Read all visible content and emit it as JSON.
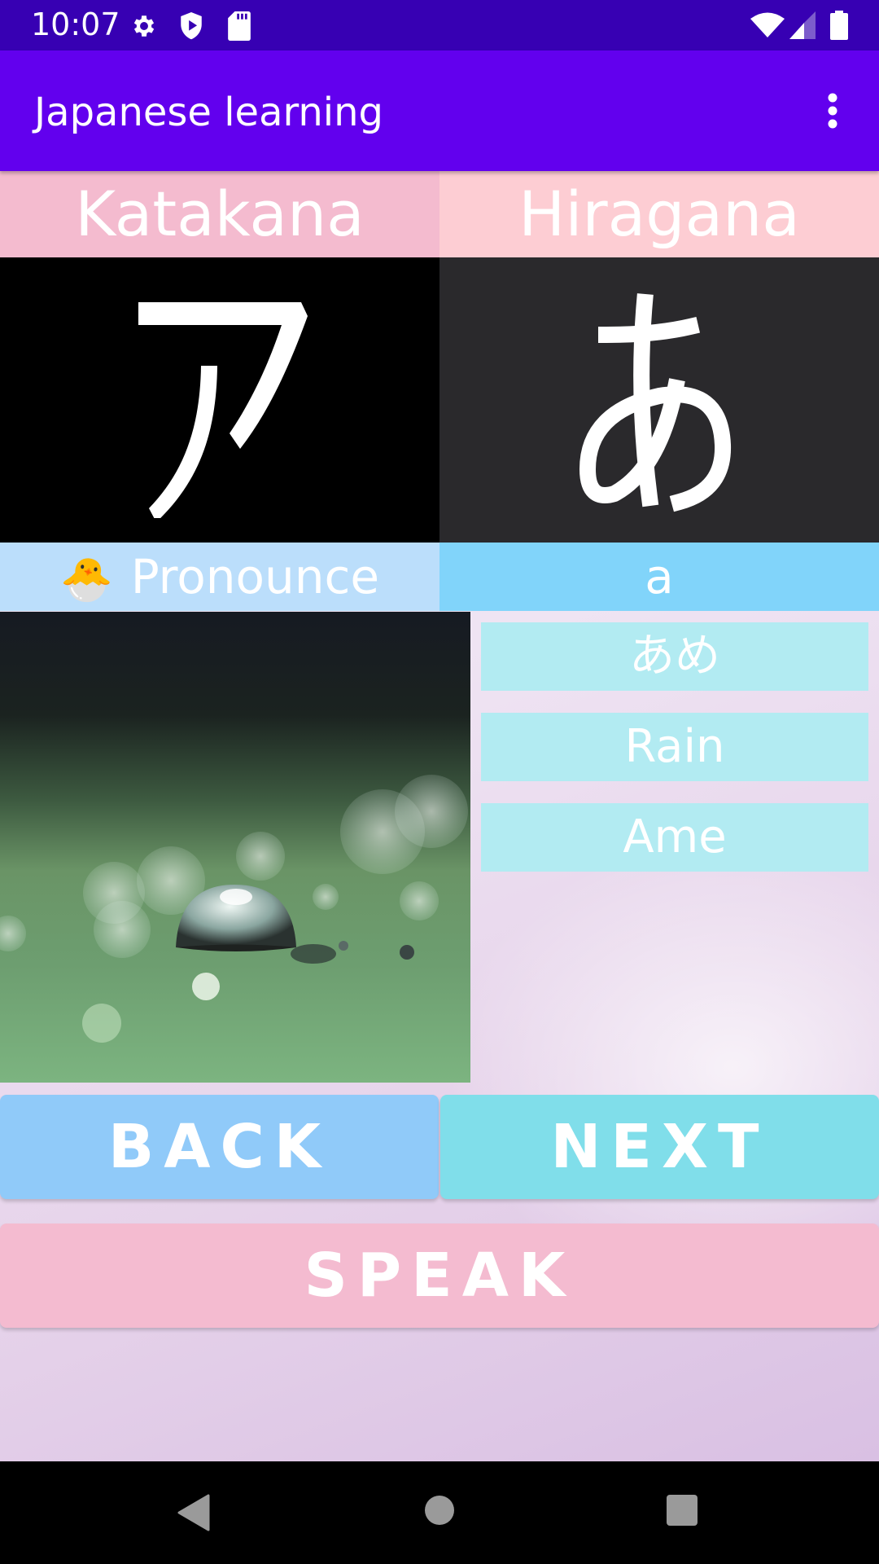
{
  "status_bar": {
    "time": "10:07",
    "left_icons": [
      "gear-icon",
      "shield-play-icon",
      "sd-card-icon"
    ],
    "right_icons": [
      "wifi-icon",
      "cell-signal-icon",
      "battery-icon"
    ]
  },
  "app_bar": {
    "title": "Japanese learning",
    "menu_icon": "more-vert-icon"
  },
  "tabs": {
    "katakana": "Katakana",
    "hiragana": "Hiragana"
  },
  "characters": {
    "katakana": "ア",
    "hiragana": "あ"
  },
  "pronounce": {
    "emoji": "🐣",
    "label": "Pronounce",
    "value": "a"
  },
  "word": {
    "image_description": "water droplet on green leaf",
    "kana": "あめ",
    "meaning": "Rain",
    "romaji": "Ame"
  },
  "buttons": {
    "back": "BACK",
    "next": "NEXT",
    "speak": "SPEAK"
  },
  "nav_bar": {
    "back": "nav-back-icon",
    "home": "nav-home-icon",
    "recents": "nav-recents-icon"
  },
  "colors": {
    "status_bar": "#3700b3",
    "app_bar": "#6200ee",
    "katakana_tab": "#f4bbcf",
    "hiragana_tab": "#fdcdd3",
    "pronounce_label": "#bbdefb",
    "pronounce_value": "#81d4fa",
    "word_card": "#b2ebf2",
    "back_button": "#90caf9",
    "next_button": "#80deea",
    "speak_button": "#f4bbd0"
  }
}
